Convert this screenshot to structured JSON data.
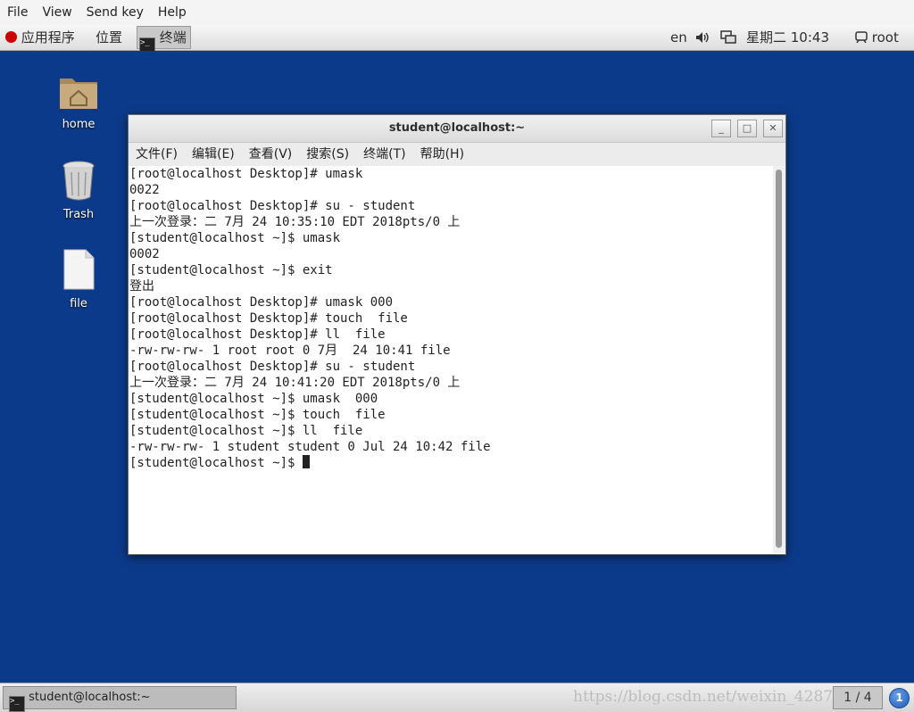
{
  "host_menu": {
    "items": [
      "File",
      "View",
      "Send key",
      "Help"
    ]
  },
  "top_panel": {
    "applications": "应用程序",
    "places": "位置",
    "task_label": "终端",
    "lang": "en",
    "datetime": "星期二 10:43",
    "user": "root"
  },
  "desktop_icons": {
    "home": "home",
    "trash": "Trash",
    "file": "file"
  },
  "terminal": {
    "title": "student@localhost:~",
    "menu": [
      "文件(F)",
      "编辑(E)",
      "查看(V)",
      "搜索(S)",
      "终端(T)",
      "帮助(H)"
    ],
    "lines": [
      "[root@localhost Desktop]# umask",
      "0022",
      "[root@localhost Desktop]# su - student",
      "上一次登录：二 7月 24 10:35:10 EDT 2018pts/0 上",
      "[student@localhost ~]$ umask",
      "0002",
      "[student@localhost ~]$ exit",
      "登出",
      "[root@localhost Desktop]# umask 000",
      "[root@localhost Desktop]# touch  file",
      "[root@localhost Desktop]# ll  file",
      "-rw-rw-rw- 1 root root 0 7月  24 10:41 file",
      "[root@localhost Desktop]# su - student",
      "上一次登录：二 7月 24 10:41:20 EDT 2018pts/0 上",
      "[student@localhost ~]$ umask  000",
      "[student@localhost ~]$ touch  file",
      "[student@localhost ~]$ ll  file",
      "-rw-rw-rw- 1 student student 0 Jul 24 10:42 file",
      "[student@localhost ~]$ "
    ]
  },
  "bottom_panel": {
    "task": "student@localhost:~",
    "watermark": "https://blog.csdn.net/weixin_4287",
    "pager": "1 / 4",
    "notify_count": "1"
  }
}
